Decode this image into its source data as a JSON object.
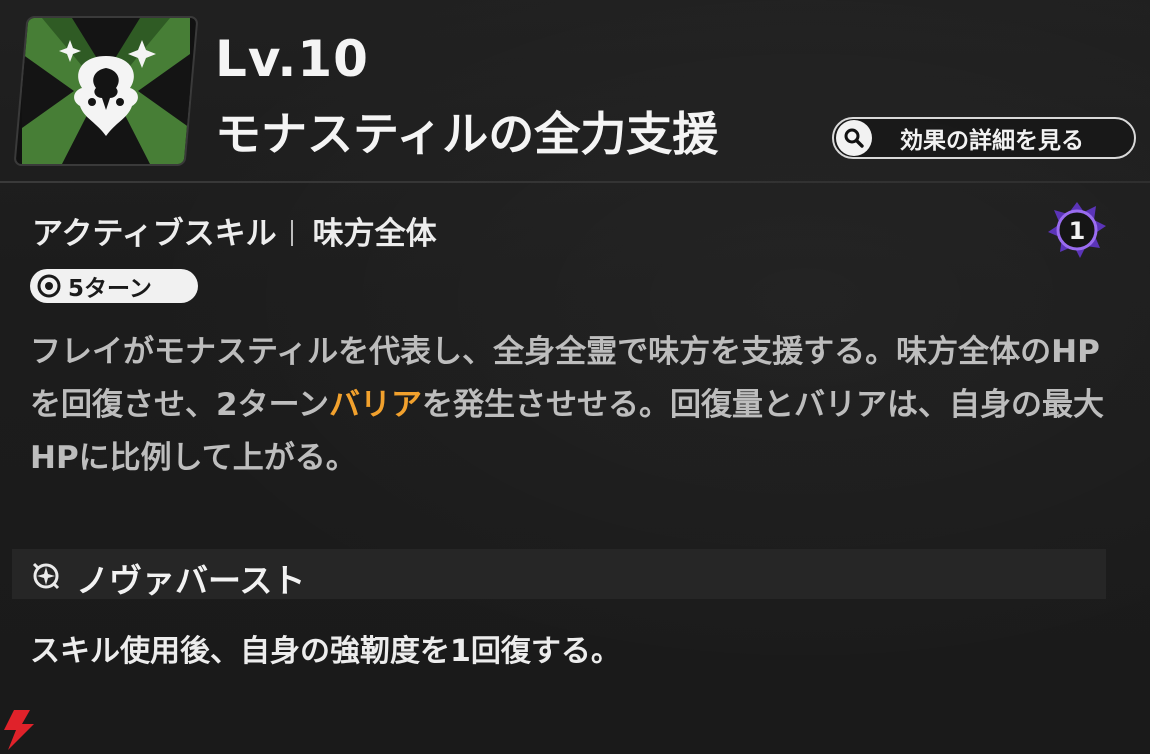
{
  "header": {
    "level": "Lv.10",
    "skill_name": "モナスティルの全力支援",
    "detail_button": "効果の詳細を見る"
  },
  "skill": {
    "type": "アクティブスキル",
    "target": "味方全体",
    "counter": "1",
    "turns": "5ターン",
    "description": {
      "part1": "フレイがモナスティルを代表し、全身全霊で味方を支援する。味方全体のHPを回復させ、2ターン",
      "highlight": "バリア",
      "part2": "を発生させせる。回復量とバリアは、自身の最大HPに比例して上がる。"
    }
  },
  "nova": {
    "title": "ノヴァバースト",
    "description": "スキル使用後、自身の強靭度を1回復する。"
  },
  "colors": {
    "highlight": "#f2a12d",
    "counter_accent": "#7b4fd6",
    "icon_green": "#4d8a3a"
  },
  "icons": {
    "skill": "skill-emblem-icon",
    "search": "search-icon",
    "counter": "counter-badge-icon",
    "clock": "clock-icon",
    "nova": "nova-burst-icon"
  }
}
